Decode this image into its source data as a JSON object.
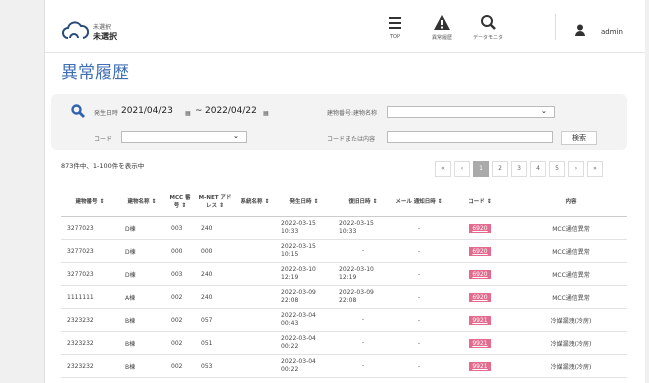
{
  "header": {
    "site_small": "未選択",
    "site_main": "未選択",
    "nav": [
      {
        "label": "TOP",
        "icon": "menu-icon"
      },
      {
        "label": "異常履歴",
        "icon": "warning-icon"
      },
      {
        "label": "データモニタ",
        "icon": "search-icon"
      }
    ],
    "user": "admin"
  },
  "page_title": "異常履歴",
  "search": {
    "date_label": "発生日時",
    "date_from": "2021/04/23",
    "date_sep": "~",
    "date_to": "2022/04/22",
    "building_label": "建物番号:建物名称",
    "code_label": "コード",
    "code_or_content_label": "コードまたは内容",
    "search_button": "検索"
  },
  "result_count": "873件中、1-100件を表示中",
  "pagination": [
    "«",
    "‹",
    "1",
    "2",
    "3",
    "4",
    "5",
    "›",
    "»"
  ],
  "table": {
    "headers": [
      "建物番号",
      "建物名称",
      "MCC 番号",
      "M-NET アドレス",
      "系統名称",
      "発生日時",
      "復旧日時",
      "メール 通知日時",
      "コード",
      "内容"
    ],
    "rows": [
      {
        "bno": "3277023",
        "bname": "D棟",
        "mcc": "003",
        "mnet": "240",
        "sys": "",
        "occ": "2022-03-15 10:33",
        "rec": "2022-03-15 10:33",
        "mail": "-",
        "code": "6920",
        "content": "MCC通信異常"
      },
      {
        "bno": "3277023",
        "bname": "D棟",
        "mcc": "000",
        "mnet": "000",
        "sys": "",
        "occ": "2022-03-15 10:15",
        "rec": "-",
        "mail": "-",
        "code": "6920",
        "content": "MCC通信異常"
      },
      {
        "bno": "3277023",
        "bname": "D棟",
        "mcc": "003",
        "mnet": "240",
        "sys": "",
        "occ": "2022-03-10 12:19",
        "rec": "2022-03-10 12:19",
        "mail": "-",
        "code": "6920",
        "content": "MCC通信異常"
      },
      {
        "bno": "1111111",
        "bname": "A棟",
        "mcc": "002",
        "mnet": "240",
        "sys": "",
        "occ": "2022-03-09 22:08",
        "rec": "2022-03-09 22:08",
        "mail": "-",
        "code": "6920",
        "content": "MCC通信異常"
      },
      {
        "bno": "2323232",
        "bname": "B棟",
        "mcc": "002",
        "mnet": "057",
        "sys": "",
        "occ": "2022-03-04 00:43",
        "rec": "-",
        "mail": "-",
        "code": "9921",
        "content": "冷媒漏洩(冷房)"
      },
      {
        "bno": "2323232",
        "bname": "B棟",
        "mcc": "002",
        "mnet": "051",
        "sys": "",
        "occ": "2022-03-04 00:22",
        "rec": "-",
        "mail": "-",
        "code": "9921",
        "content": "冷媒漏洩(冷房)"
      },
      {
        "bno": "2323232",
        "bname": "B棟",
        "mcc": "002",
        "mnet": "053",
        "sys": "",
        "occ": "2022-03-04 00:22",
        "rec": "-",
        "mail": "-",
        "code": "9921",
        "content": "冷媒漏洩(冷房)"
      }
    ]
  }
}
